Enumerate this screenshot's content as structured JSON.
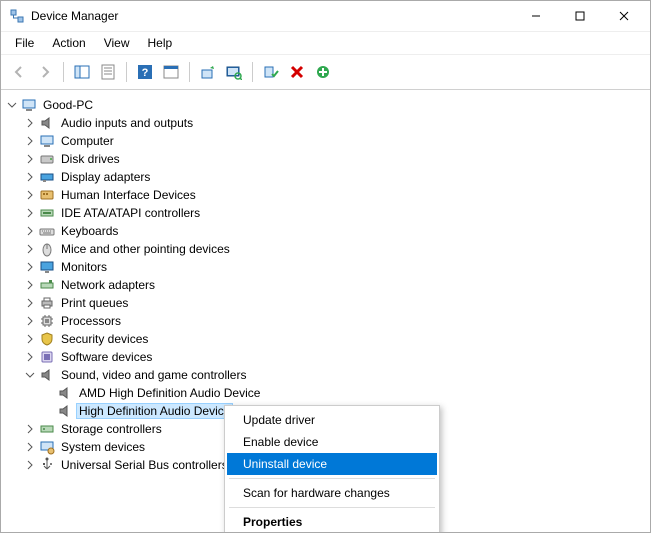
{
  "window": {
    "title": "Device Manager"
  },
  "menu": {
    "file": "File",
    "action": "Action",
    "view": "View",
    "help": "Help"
  },
  "tree": {
    "root": {
      "label": "Good-PC"
    },
    "nodes": {
      "audio_io": {
        "label": "Audio inputs and outputs"
      },
      "computer": {
        "label": "Computer"
      },
      "disk": {
        "label": "Disk drives"
      },
      "display": {
        "label": "Display adapters"
      },
      "hid": {
        "label": "Human Interface Devices"
      },
      "ide": {
        "label": "IDE ATA/ATAPI controllers"
      },
      "keyboards": {
        "label": "Keyboards"
      },
      "mice": {
        "label": "Mice and other pointing devices"
      },
      "monitors": {
        "label": "Monitors"
      },
      "net": {
        "label": "Network adapters"
      },
      "printq": {
        "label": "Print queues"
      },
      "processors": {
        "label": "Processors"
      },
      "security": {
        "label": "Security devices"
      },
      "software": {
        "label": "Software devices"
      },
      "sound": {
        "label": "Sound, video and game controllers"
      },
      "sound_child_amd": {
        "label": "AMD High Definition Audio Device"
      },
      "sound_child_hd": {
        "label": "High Definition Audio Device"
      },
      "storage": {
        "label": "Storage controllers"
      },
      "system": {
        "label": "System devices"
      },
      "usb": {
        "label": "Universal Serial Bus controllers"
      }
    }
  },
  "context_menu": {
    "update": "Update driver",
    "enable": "Enable device",
    "uninstall": "Uninstall device",
    "scan": "Scan for hardware changes",
    "properties": "Properties"
  }
}
